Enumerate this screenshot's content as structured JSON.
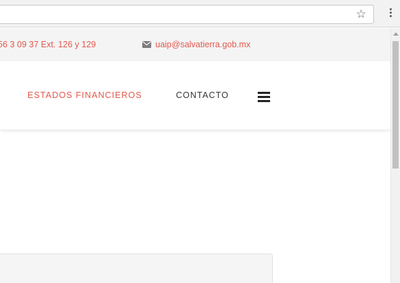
{
  "browser": {
    "address_bar_value": "",
    "bookmark_icon": "star-icon",
    "menu_icon": "kebab-menu-icon"
  },
  "topbar": {
    "phone": "56 3 09 37 Ext. 126 y 129",
    "email_icon": "envelope-icon",
    "email": "uaip@salvatierra.gob.mx"
  },
  "nav": {
    "items": [
      {
        "label": "ESTADOS FINANCIEROS",
        "active": true
      },
      {
        "label": "CONTACTO",
        "active": false
      }
    ],
    "menu_icon": "hamburger-icon"
  },
  "colors": {
    "accent": "#e2584d",
    "nav_text": "#333333",
    "topbar_bg": "#f4f4f4"
  }
}
